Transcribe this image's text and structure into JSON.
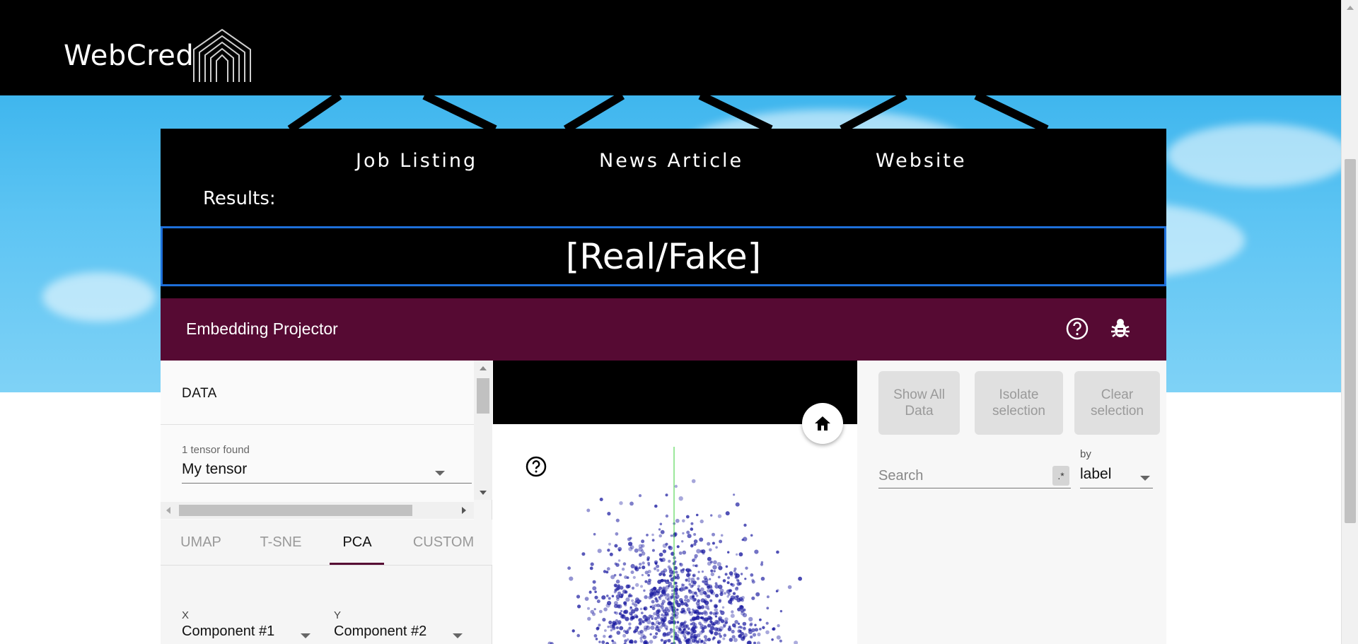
{
  "header": {
    "brand": "WebCred",
    "logo_icon": "arch-logo-icon"
  },
  "nav": {
    "items": [
      "Job Listing",
      "News Article",
      "Website"
    ]
  },
  "results": {
    "label": "Results:",
    "value": "[Real/Fake]"
  },
  "projector": {
    "title": "Embedding Projector",
    "help_icon": "help-circle-icon",
    "bug_icon": "bug-icon",
    "header_color": "#560a33",
    "data": {
      "title": "DATA",
      "tensor_caption": "1 tensor found",
      "tensor_value": "My tensor"
    },
    "tabs": [
      {
        "label": "UMAP",
        "active": false
      },
      {
        "label": "T-SNE",
        "active": false
      },
      {
        "label": "PCA",
        "active": true
      },
      {
        "label": "CUSTOM",
        "active": false
      }
    ],
    "components": {
      "x_label": "X",
      "x_value": "Component #1",
      "y_label": "Y",
      "y_value": "Component #2"
    },
    "right": {
      "show_all": "Show All Data",
      "isolate": "Isolate selection",
      "clear": "Clear selection",
      "search_placeholder": "Search",
      "regex": ".*",
      "by_label": "by",
      "by_value": "label"
    },
    "point_color": "#1a1aa0"
  }
}
